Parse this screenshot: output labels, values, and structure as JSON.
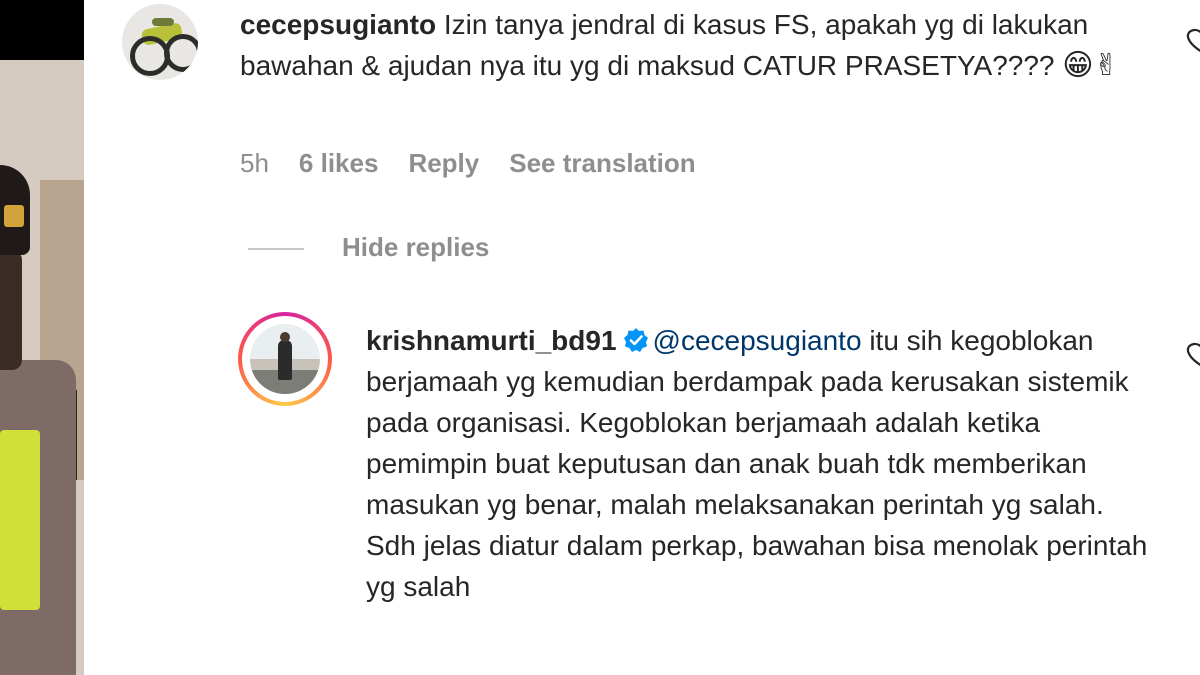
{
  "comment1": {
    "username": "cecepsugianto",
    "text": "Izin tanya jendral di kasus FS, apakah yg di lakukan bawahan & ajudan nya itu yg di maksud CATUR PRASETYA????",
    "emojis": "😁✌",
    "time": "5h",
    "likes": "6 likes",
    "reply": "Reply",
    "see_translation": "See translation",
    "like_icon": "heart-outline-icon"
  },
  "replies_toggle": {
    "label": "Hide replies"
  },
  "comment2": {
    "username": "krishnamurti_bd91",
    "verified_icon": "verified-badge-icon",
    "mention": "@cecepsugianto",
    "text": "itu sih kegoblokan berjamaah yg kemudian berdampak pada kerusakan sistemik pada organisasi. Kegoblokan berjamaah adalah ketika pemimpin buat keputusan dan anak buah tdk memberikan masukan yg benar, malah melaksanakan perintah yg salah. Sdh jelas diatur dalam perkap, bawahan bisa menolak perintah yg salah",
    "like_icon": "heart-outline-icon"
  },
  "colors": {
    "text": "#262626",
    "meta": "#8e8e8e",
    "mention": "#00376b",
    "verified": "#0095f6"
  }
}
